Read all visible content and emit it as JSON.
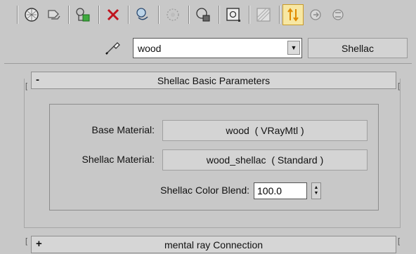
{
  "toolbar": {
    "buttons": [
      {
        "icon": "get-material-icon",
        "active": false
      },
      {
        "icon": "put-to-scene-icon",
        "active": false
      },
      {
        "icon": "assign-to-selection-icon",
        "active": false
      },
      {
        "icon": "reset-map-icon",
        "active": false
      },
      {
        "icon": "make-unique-icon",
        "active": false
      },
      {
        "icon": "put-to-library-icon",
        "active": false
      },
      {
        "icon": "material-effects-channel-icon",
        "active": false
      },
      {
        "icon": "show-map-in-viewport-icon",
        "active": false
      },
      {
        "icon": "show-end-result-icon",
        "active": false
      },
      {
        "icon": "go-to-parent-icon",
        "active": true
      },
      {
        "icon": "go-forward-to-sibling-icon",
        "active": false
      },
      {
        "icon": "material-navigator-icon",
        "active": false
      }
    ]
  },
  "material": {
    "name": "wood",
    "type_button": "Shellac"
  },
  "rollouts": {
    "basic": {
      "sign": "-",
      "title": "Shellac Basic Parameters"
    },
    "mental_ray": {
      "sign": "+",
      "title": "mental ray Connection"
    }
  },
  "params": {
    "base_label": "Base Material:",
    "base_value": "wood  ( VRayMtl )",
    "shellac_label": "Shellac Material:",
    "shellac_value": "wood_shellac  ( Standard )",
    "blend_label": "Shellac Color Blend:",
    "blend_value": "100.0"
  }
}
